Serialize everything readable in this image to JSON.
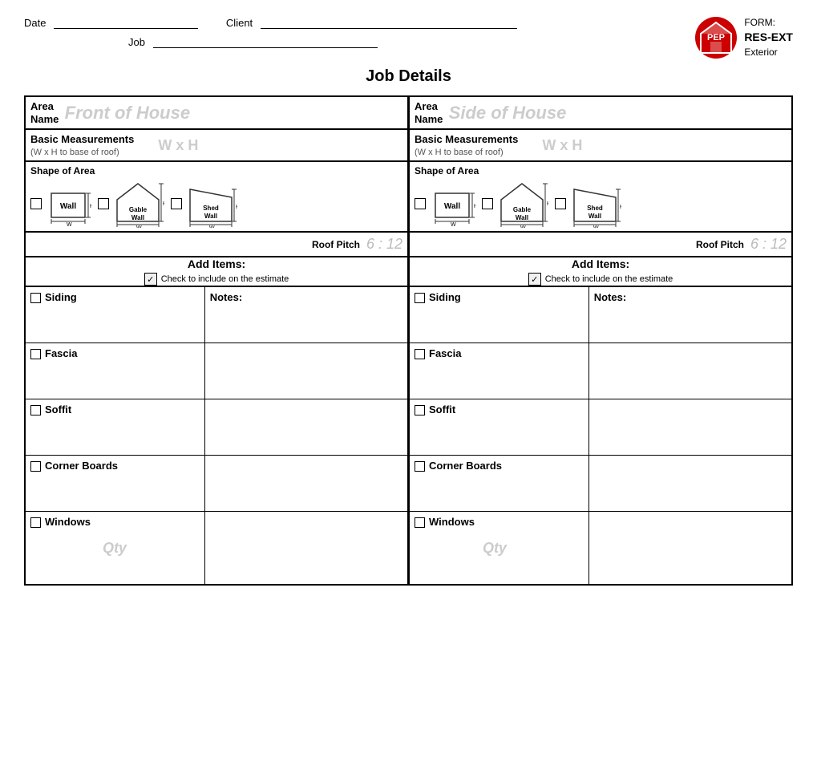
{
  "header": {
    "date_label": "Date",
    "client_label": "Client",
    "job_label": "Job",
    "form_label": "FORM:",
    "form_name": "RES-EXT",
    "form_type": "Exterior",
    "logo_text": "PEP"
  },
  "page_title": "Job Details",
  "left_area": {
    "area_label": "Area\nName",
    "area_value": "Front of House",
    "meas_title": "Basic Measurements",
    "meas_subtitle": "(W x H to base of roof)",
    "meas_wxh": "W  x  H",
    "shape_title": "Shape of Area",
    "shapes": [
      "Wall",
      "Gable Wall",
      "Shed Wall"
    ],
    "roof_pitch_label": "Roof Pitch",
    "roof_pitch_value": "6 : 12",
    "add_items_title": "Add Items:",
    "check_instruction": "Check to include on the estimate",
    "items": [
      {
        "name": "Siding"
      },
      {
        "name": "Fascia"
      },
      {
        "name": "Soffit"
      },
      {
        "name": "Corner Boards"
      },
      {
        "name": "Windows"
      }
    ],
    "notes_label": "Notes:",
    "qty_label": "Qty"
  },
  "right_area": {
    "area_label": "Area\nName",
    "area_value": "Side of House",
    "meas_title": "Basic Measurements",
    "meas_subtitle": "(W x H to base of roof)",
    "meas_wxh": "W  x  H",
    "shape_title": "Shape of Area",
    "shapes": [
      "Wall",
      "Gable Wall",
      "Shed Wall"
    ],
    "roof_pitch_label": "Roof Pitch",
    "roof_pitch_value": "6 : 12",
    "add_items_title": "Add Items:",
    "check_instruction": "Check to include on the estimate",
    "items": [
      {
        "name": "Siding"
      },
      {
        "name": "Fascia"
      },
      {
        "name": "Soffit"
      },
      {
        "name": "Corner Boards"
      },
      {
        "name": "Windows"
      }
    ],
    "notes_label": "Notes:",
    "qty_label": "Qty"
  }
}
